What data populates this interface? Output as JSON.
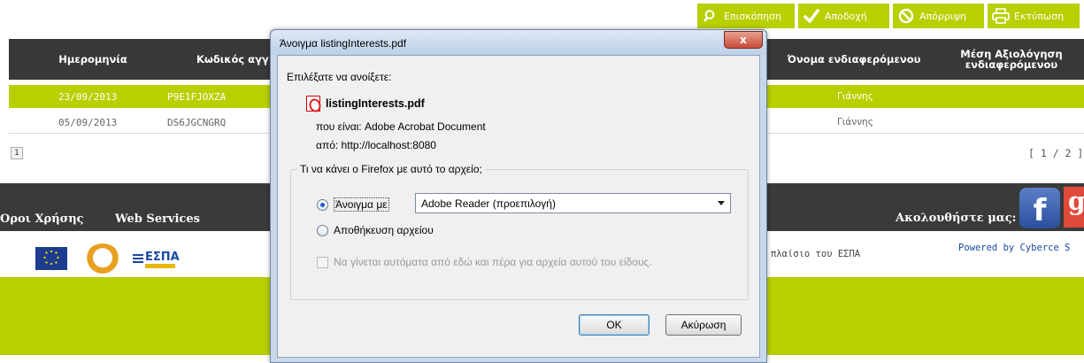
{
  "actions": [
    {
      "label": "Επισκόπηση",
      "icon": "search-icon"
    },
    {
      "label": "Αποδοχή",
      "icon": "checkmark-icon"
    },
    {
      "label": "Απόρριψη",
      "icon": "block-icon"
    },
    {
      "label": "Εκτύπωση",
      "icon": "printer-icon"
    }
  ],
  "table": {
    "headers": [
      "Ημερομηνία",
      "Κωδικός αγγ",
      "Όνομα ενδιαφερόμενου",
      "Μέση Αξιολόγηση ενδιαφερόμενου"
    ],
    "rows": [
      {
        "date": "23/09/2013",
        "code": "P9E1FJOXZA",
        "name": "Γιάννης"
      },
      {
        "date": "05/09/2013",
        "code": "DS6JGCNGRQ",
        "name": "Γιάννης"
      }
    ],
    "page_button": "1",
    "page_info": "[ 1 / 2 ]"
  },
  "footer": {
    "terms": "Οροι Χρήσης",
    "web_services": "Web Services",
    "follow": "Ακολουθήστε μας:",
    "facebook_letter": "f",
    "google_letter": "g",
    "espa_logo_text": "ΕΣΠΑ",
    "espa_text": "το πλαίσιο του ΕΣΠΑ",
    "powered": "Powered by Cyberce S"
  },
  "dialog": {
    "title": "Άνοιγμα listingInterests.pdf",
    "close": "x",
    "prompt": "Επιλέξατε να ανοίξετε:",
    "filename": "listingInterests.pdf",
    "kind": "που είναι:  Adobe Acrobat Document",
    "from": "από:  http://localhost:8080",
    "group_title": "Τι να κάνει ο Firefox  με αυτό το αρχείο;",
    "open_with_label": "Άνοιγμα με",
    "open_with_value": "Adobe Reader  (προεπιλογή)",
    "save_label": "Αποθήκευση αρχείου",
    "auto_label": "Να γίνεται αυτόματα από εδώ και πέρα για αρχεία αυτού του είδους.",
    "ok": "OK",
    "cancel": "Ακύρωση"
  },
  "colors": {
    "accent": "#b8d000",
    "dark": "#383838",
    "link": "#1a4aa0"
  }
}
